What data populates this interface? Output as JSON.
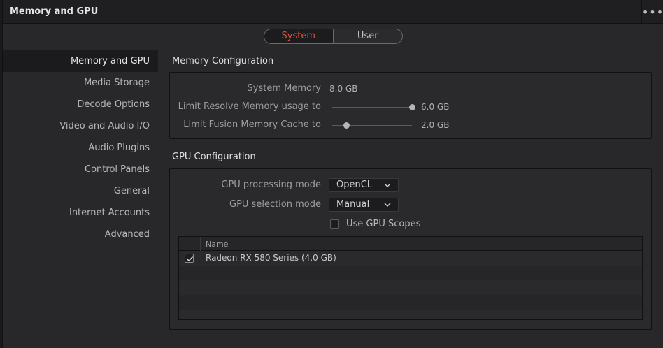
{
  "window": {
    "title": "Memory and GPU",
    "more_icon": "ellipsis-icon"
  },
  "tabs": [
    {
      "label": "System",
      "active": true
    },
    {
      "label": "User",
      "active": false
    }
  ],
  "sidebar": {
    "items": [
      {
        "label": "Memory and GPU",
        "active": true
      },
      {
        "label": "Media Storage"
      },
      {
        "label": "Decode Options"
      },
      {
        "label": "Video and Audio I/O"
      },
      {
        "label": "Audio Plugins"
      },
      {
        "label": "Control Panels"
      },
      {
        "label": "General"
      },
      {
        "label": "Internet Accounts"
      },
      {
        "label": "Advanced"
      }
    ]
  },
  "memory": {
    "title": "Memory Configuration",
    "system_memory_label": "System Memory",
    "system_memory_value": "8.0 GB",
    "resolve_label": "Limit Resolve Memory usage to",
    "resolve_value": "6.0 GB",
    "resolve_fraction": 1.0,
    "fusion_label": "Limit Fusion Memory Cache to",
    "fusion_value": "2.0 GB",
    "fusion_fraction": 0.18
  },
  "gpu": {
    "title": "GPU Configuration",
    "processing_label": "GPU processing mode",
    "processing_value": "OpenCL",
    "selection_label": "GPU selection mode",
    "selection_value": "Manual",
    "scopes_label": "Use GPU Scopes",
    "scopes_checked": false,
    "table": {
      "header_name": "Name",
      "rows": [
        {
          "name": "Radeon RX 580 Series (4.0 GB)",
          "checked": true
        }
      ]
    }
  },
  "colors": {
    "accent": "#e0503c"
  }
}
